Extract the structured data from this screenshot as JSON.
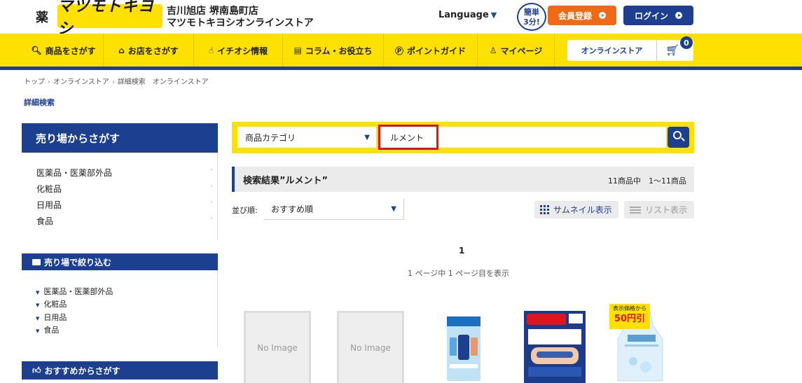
{
  "header": {
    "yaku": "薬",
    "logo": "マツモトキヨシ",
    "store_line1": "吉川旭店 堺南島町店",
    "store_line2": "マツモトキヨシオンラインストア",
    "language": "Language",
    "kantan_line1": "簡単",
    "kantan_line2": "3分!",
    "member_btn": "会員登録",
    "login_btn": "ログイン"
  },
  "nav": {
    "items": [
      {
        "label": "商品をさがす",
        "icon": "search-icon"
      },
      {
        "label": "お店をさがす",
        "icon": "store-icon"
      },
      {
        "label": "イチオシ情報",
        "icon": "thumbs-up-icon"
      },
      {
        "label": "コラム・お役立ち",
        "icon": "document-icon"
      },
      {
        "label": "ポイントガイド",
        "icon": "point-icon"
      },
      {
        "label": "マイページ",
        "icon": "person-icon"
      }
    ],
    "online_store": "オンラインストア",
    "cart_count": "0"
  },
  "breadcrumb": [
    "トップ",
    "オンラインストア",
    "詳細検索　オンラインストア"
  ],
  "detail_search_link": "詳細検索",
  "sidebar": {
    "section1_title": "売り場からさがす",
    "section1_items": [
      "医薬品・医薬部外品",
      "化粧品",
      "日用品",
      "食品"
    ],
    "section2_title": "売り場で絞り込む",
    "section2_items": [
      "医薬品・医薬部外品",
      "化粧品",
      "日用品",
      "食品"
    ],
    "section3_title": "おすすめからさがす"
  },
  "search": {
    "category": "商品カテゴリ",
    "keyword": "ルメント"
  },
  "results": {
    "title": "検索結果”ルメント”",
    "count": "11商品中　1〜11商品",
    "sort_label": "並び順:",
    "sort_value": "おすすめ順",
    "thumbnail_btn": "サムネイル表示",
    "list_btn": "リスト表示",
    "page": "1",
    "page_info": "1 ページ中 1 ページ目を表示",
    "no_image": "No Image",
    "discount_label": "表示価格から",
    "discount_value": "50円引"
  },
  "colors": {
    "brand_yellow": "#ffe100",
    "brand_navy": "#1d3f8f",
    "member_orange": "#ef6a17",
    "highlight_red": "#e0141e"
  }
}
